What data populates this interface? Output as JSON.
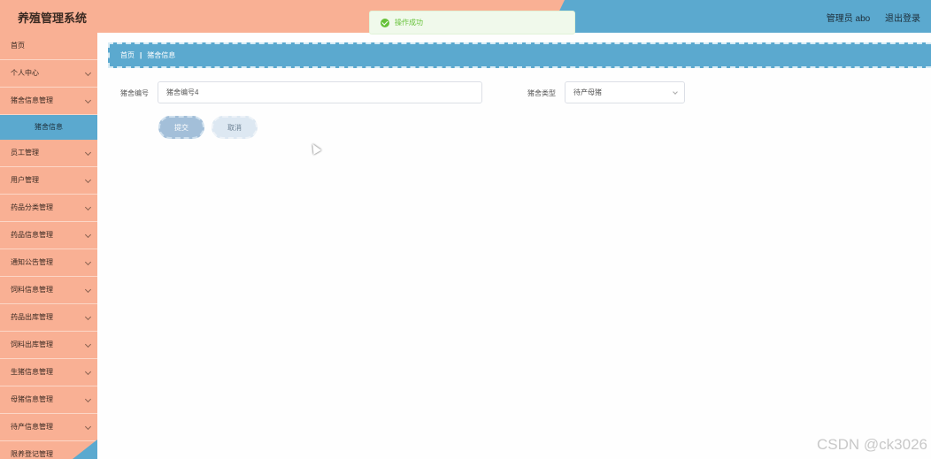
{
  "app": {
    "title": "养殖管理系统"
  },
  "header": {
    "user_label": "管理员 abo",
    "logout_label": "退出登录"
  },
  "toast": {
    "message": "操作成功",
    "icon": "success-check-icon",
    "color": "#67c23a"
  },
  "sidebar": {
    "items": [
      {
        "label": "首页",
        "has_chevron": false
      },
      {
        "label": "个人中心",
        "has_chevron": true
      },
      {
        "label": "猪舍信息管理",
        "has_chevron": true
      },
      {
        "label": "猪舍信息",
        "sub": true
      },
      {
        "label": "员工管理",
        "has_chevron": true
      },
      {
        "label": "用户管理",
        "has_chevron": true
      },
      {
        "label": "药品分类管理",
        "has_chevron": true
      },
      {
        "label": "药品信息管理",
        "has_chevron": true
      },
      {
        "label": "通知公告管理",
        "has_chevron": true
      },
      {
        "label": "饲料信息管理",
        "has_chevron": true
      },
      {
        "label": "药品出库管理",
        "has_chevron": true
      },
      {
        "label": "饲料出库管理",
        "has_chevron": true
      },
      {
        "label": "生猪信息管理",
        "has_chevron": true
      },
      {
        "label": "母猪信息管理",
        "has_chevron": true
      },
      {
        "label": "待产信息管理",
        "has_chevron": true
      },
      {
        "label": "限养登记管理",
        "has_chevron": true
      }
    ]
  },
  "breadcrumb": {
    "home": "首页",
    "separator": "|",
    "current": "猪舍信息"
  },
  "form": {
    "pen_number_label": "猪舍编号",
    "pen_number_value": "猪舍编号4",
    "pen_type_label": "猪舍类型",
    "pen_type_value": "待产母猪",
    "submit_label": "提交",
    "cancel_label": "取消"
  },
  "watermark": "CSDN @ck3026",
  "colors": {
    "salmon": "#f9b094",
    "blue": "#5ba9cf"
  }
}
